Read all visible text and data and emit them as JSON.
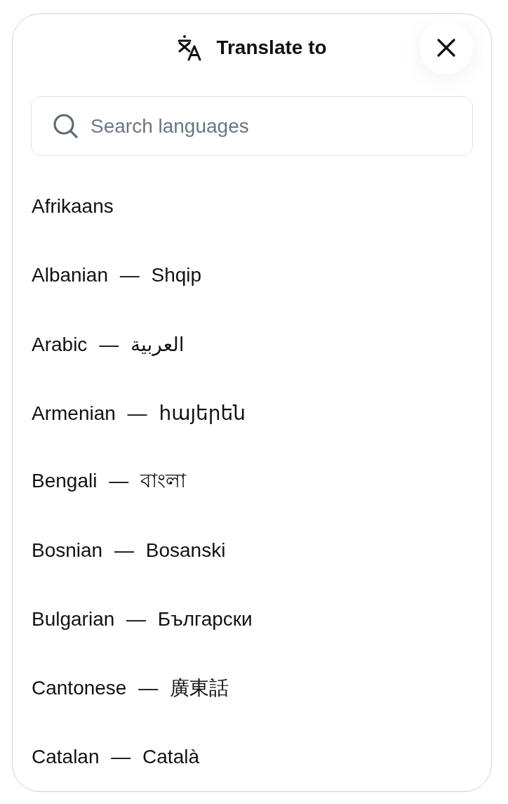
{
  "header": {
    "title": "Translate to"
  },
  "search": {
    "placeholder": "Search languages"
  },
  "languages": [
    {
      "label": "Afrikaans"
    },
    {
      "label": "Albanian — Shqip"
    },
    {
      "label": "Arabic — العربية"
    },
    {
      "label": "Armenian — հայերեն"
    },
    {
      "label": "Bengali — বাংলা"
    },
    {
      "label": "Bosnian — Bosanski"
    },
    {
      "label": "Bulgarian — Български"
    },
    {
      "label": "Cantonese — 廣東話"
    },
    {
      "label": "Catalan — Català"
    }
  ]
}
